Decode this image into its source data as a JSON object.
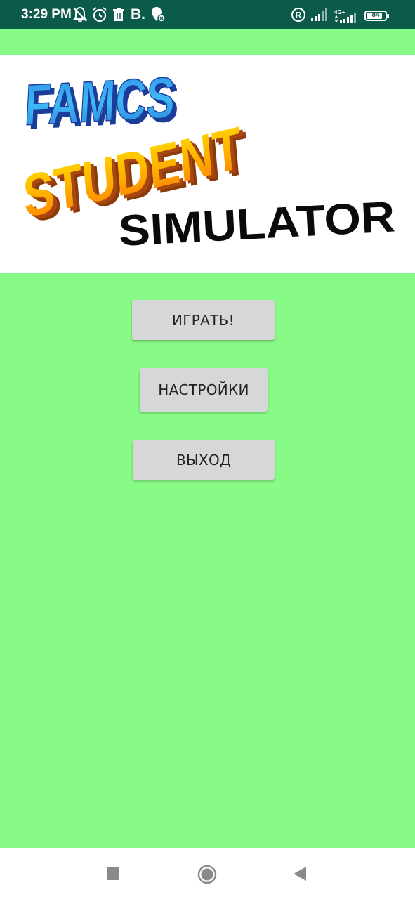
{
  "status_bar": {
    "time": "3:29 PM",
    "b_label": "B.",
    "network_label": "4G+",
    "battery_text": "84",
    "battery_level": 0.84,
    "icons": [
      "notifications-off-icon",
      "alarm-icon",
      "trash-icon",
      "b-app-icon",
      "location-icon",
      "registered-icon",
      "signal-icon",
      "signal-4g-icon",
      "battery-icon"
    ]
  },
  "banner": {
    "line1": "FAMCS",
    "line2": "STUDENT",
    "line3": "SIMULATOR"
  },
  "menu": {
    "play_label": "ИГРАТЬ!",
    "settings_label": "НАСТРОЙКИ",
    "exit_label": "ВЫХОД"
  },
  "nav_bar": {
    "icons": [
      "recents-icon",
      "home-icon",
      "back-icon"
    ]
  },
  "colors": {
    "background": "#88fb86",
    "status_bar": "#0b5a4a",
    "button": "#d6d7d7",
    "famcs_blue": "#3fa9f5",
    "student_orange": "#ffb800",
    "student_shadow": "#8b3a0b"
  }
}
